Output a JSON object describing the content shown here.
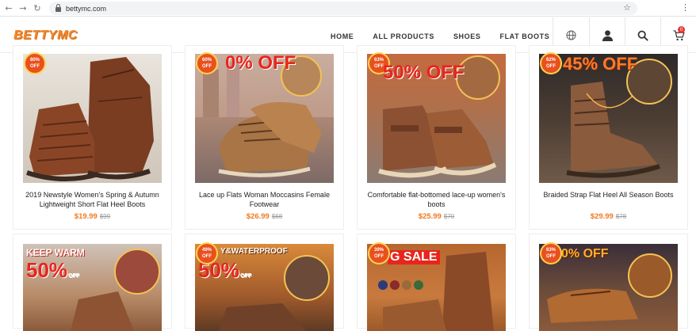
{
  "browser": {
    "url": "bettymc.com"
  },
  "site": {
    "logo": "BETTYMC",
    "menu": [
      "HOME",
      "ALL PRODUCTS",
      "SHOES",
      "FLAT BOOTS"
    ],
    "cart_count": "0"
  },
  "products": [
    {
      "title": "2019 Newstyle Women's Spring & Autumn Lightweight Short Flat Heel Boots",
      "price": "$19.99",
      "old_price": "$99",
      "badge": "80% OFF",
      "promo": ""
    },
    {
      "title": "Lace up Flats Woman Moccasins Female Footwear",
      "price": "$26.99",
      "old_price": "$68",
      "badge": "60% OFF",
      "promo": "0% OFF"
    },
    {
      "title": "Comfortable flat-bottomed lace-up women's boots",
      "price": "$25.99",
      "old_price": "$70",
      "badge": "63% OFF",
      "promo": "50% OFF"
    },
    {
      "title": "Braided Strap Flat Heel All Season Boots",
      "price": "$29.99",
      "old_price": "$78",
      "badge": "62% OFF",
      "promo": "45% OFF"
    }
  ],
  "row2": [
    {
      "promo_top": "KEEP WARM",
      "promo": "50%",
      "promo_suffix": "OFF",
      "badge": ""
    },
    {
      "promo_top": "Y&WATERPROOF",
      "promo": "50%",
      "promo_suffix": "OFF",
      "badge": "49% OFF"
    },
    {
      "promo_top": "G SALE",
      "promo": "",
      "promo_suffix": "",
      "badge": "39% OFF"
    },
    {
      "promo_top": "0% OFF",
      "promo": "",
      "promo_suffix": "",
      "badge": "63% OFF"
    }
  ]
}
